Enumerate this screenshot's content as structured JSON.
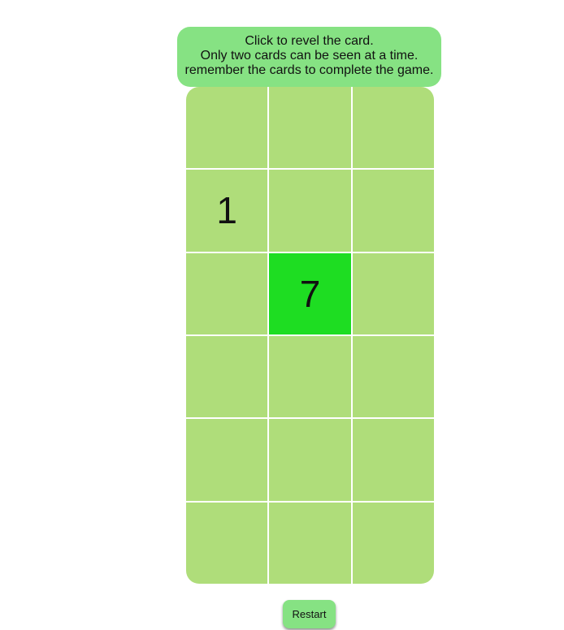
{
  "instructions": {
    "line1": "Click to revel the card.",
    "line2": "Only two cards can be seen at a time.",
    "line3": "remember the cards to complete the game."
  },
  "board": {
    "cards": [
      {
        "value": "",
        "state": "hidden"
      },
      {
        "value": "",
        "state": "hidden"
      },
      {
        "value": "",
        "state": "hidden"
      },
      {
        "value": "1",
        "state": "revealed"
      },
      {
        "value": "",
        "state": "hidden"
      },
      {
        "value": "",
        "state": "hidden"
      },
      {
        "value": "",
        "state": "hidden"
      },
      {
        "value": "7",
        "state": "selected"
      },
      {
        "value": "",
        "state": "hidden"
      },
      {
        "value": "",
        "state": "hidden"
      },
      {
        "value": "",
        "state": "hidden"
      },
      {
        "value": "",
        "state": "hidden"
      },
      {
        "value": "",
        "state": "hidden"
      },
      {
        "value": "",
        "state": "hidden"
      },
      {
        "value": "",
        "state": "hidden"
      },
      {
        "value": "",
        "state": "hidden"
      },
      {
        "value": "",
        "state": "hidden"
      },
      {
        "value": "",
        "state": "hidden"
      }
    ]
  },
  "restart_label": "Restart",
  "colors": {
    "panel": "#86e283",
    "card": "#afdd7a",
    "card_selected": "#1edd22"
  }
}
